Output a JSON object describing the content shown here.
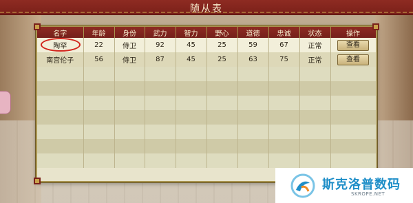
{
  "window": {
    "title": "随从表"
  },
  "table": {
    "headers": [
      "名字",
      "年龄",
      "身份",
      "武力",
      "智力",
      "野心",
      "道德",
      "忠诚",
      "状态",
      "操作"
    ],
    "rows": [
      {
        "name": "陶罕",
        "age": "22",
        "role": "侍卫",
        "force": "92",
        "intellect": "45",
        "ambition": "25",
        "morality": "59",
        "loyalty": "67",
        "status": "正常",
        "action": "查看"
      },
      {
        "name": "南宫伦子",
        "age": "56",
        "role": "侍卫",
        "force": "87",
        "intellect": "45",
        "ambition": "25",
        "morality": "63",
        "loyalty": "75",
        "status": "正常",
        "action": "查看"
      }
    ],
    "empty_row_count": 7
  },
  "watermark": {
    "title": "斯克洛普数码",
    "subtitle": "SKROPE.NET"
  },
  "colors": {
    "accent_red": "#8e2b22",
    "gold": "#a9944f",
    "highlight_circle": "#d2261d"
  }
}
